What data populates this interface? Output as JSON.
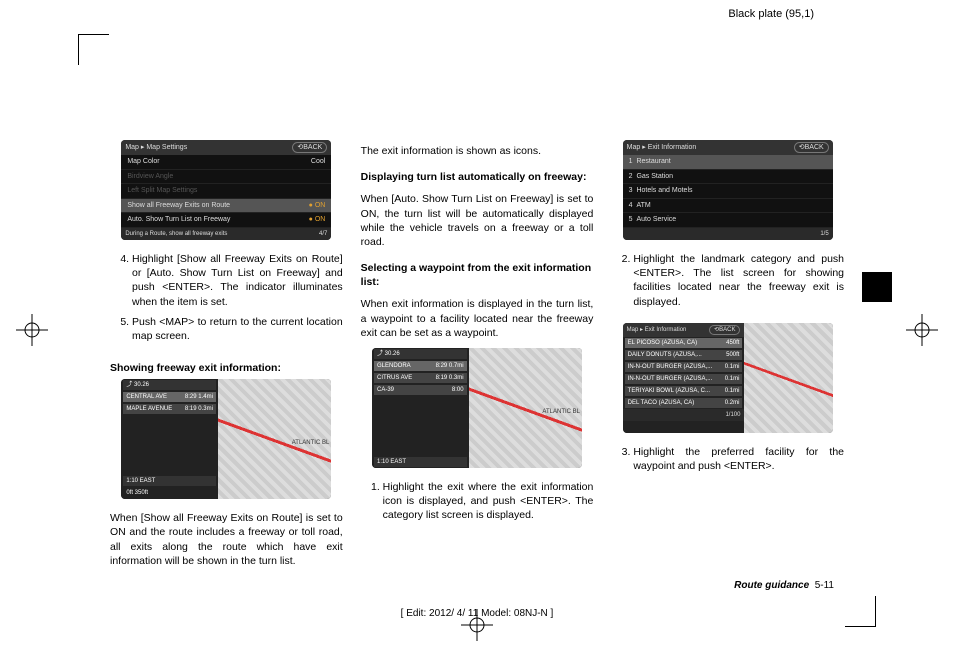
{
  "header": {
    "plate": "Black plate (95,1)"
  },
  "footer": {
    "section_label": "Route guidance",
    "section_page": "5-11",
    "edit_line": "[ Edit: 2012/ 4/ 11  Model: 08NJ-N ]"
  },
  "col1": {
    "screenshot1": {
      "breadcrumb": "Map ▸ Map Settings",
      "back": "⟲BACK",
      "rows": [
        {
          "label": "Map Color",
          "value": "Cool"
        },
        {
          "label": "Birdview Angle",
          "value": ""
        },
        {
          "label": "Left Split Map Settings",
          "value": ""
        },
        {
          "label": "Show all Freeway Exits on Route",
          "value": "● ON",
          "sel": true
        },
        {
          "label": "Auto. Show Turn List on Freeway",
          "value": "● ON"
        }
      ],
      "footer_hint": "During a Route, show all freeway exits",
      "footer_page": "4/7"
    },
    "step4": "Highlight [Show all Freeway Exits on Route] or [Auto. Show Turn List on Freeway] and push <ENTER>. The indicator illuminates when the item is set.",
    "step5": "Push <MAP> to return to the current location map screen.",
    "subhead": "Showing freeway exit information:",
    "screenshot2": {
      "top": "⤴ 30.26",
      "rows": [
        {
          "l": "CENTRAL AVE",
          "r": "8:29   1.4mi"
        },
        {
          "l": "MAPLE AVENUE",
          "r": "8:19   0.3mi"
        }
      ],
      "bottom_l": "1:10 EAST",
      "bottom_r": "0ft    350ft",
      "rlabel": "ATLANTIC BL"
    },
    "para": "When [Show all Freeway Exits on Route] is set to ON and the route includes a freeway or toll road, all exits along the route which have exit information will be shown in the turn list."
  },
  "col2": {
    "para1": "The exit information is shown as icons.",
    "subhead1": "Displaying turn list automatically on freeway:",
    "para2": "When [Auto. Show Turn List on Freeway] is set to ON, the turn list will be automatically displayed while the vehicle travels on a freeway or a toll road.",
    "subhead2": "Selecting a waypoint from the exit information list:",
    "para3": "When exit information is displayed in the turn list, a waypoint to a facility located near the freeway exit can be set as a waypoint.",
    "screenshot": {
      "top": "⤴ 30.26",
      "rows": [
        {
          "l": "GLENDORA",
          "r": "8:29   0.7mi"
        },
        {
          "l": "CITRUS AVE",
          "r": "8:19   0.3mi"
        },
        {
          "l": "CA-39",
          "r": "8:00"
        }
      ],
      "bottom_l": "1:10 EAST",
      "rlabel": "ATLANTIC BL"
    },
    "step1": "Highlight the exit where the exit information icon is displayed, and push <ENTER>. The category list screen is displayed."
  },
  "col3": {
    "screenshot1": {
      "breadcrumb": "Map ▸ Exit Information",
      "back": "⟲BACK",
      "rows": [
        {
          "n": "1",
          "label": "Restaurant",
          "sel": true
        },
        {
          "n": "2",
          "label": "Gas Station"
        },
        {
          "n": "3",
          "label": "Hotels and Motels"
        },
        {
          "n": "4",
          "label": "ATM"
        },
        {
          "n": "5",
          "label": "Auto Service"
        }
      ],
      "footer_page": "1/5"
    },
    "step2": "Highlight the landmark category and push <ENTER>. The list screen for showing facilities located near the freeway exit is displayed.",
    "screenshot2": {
      "breadcrumb": "Map ▸ Exit Information",
      "back": "⟲BACK",
      "rows": [
        {
          "l": "EL PICOSO (AZUSA, CA)",
          "r": "450ft",
          "sel": true
        },
        {
          "l": "DAILY DONUTS (AZUSA,...",
          "r": "500ft"
        },
        {
          "l": "IN-N-OUT BURGER (AZUSA,...",
          "r": "0.1mi"
        },
        {
          "l": "IN-N-OUT BURGER (AZUSA,...",
          "r": "0.1mi"
        },
        {
          "l": "TERIYAKI BOWL (AZUSA, C...",
          "r": "0.1mi"
        },
        {
          "l": "DEL TACO (AZUSA, CA)",
          "r": "0.2mi"
        }
      ],
      "footer_page": "1/100"
    },
    "step3": "Highlight the preferred facility for the waypoint and push <ENTER>."
  }
}
